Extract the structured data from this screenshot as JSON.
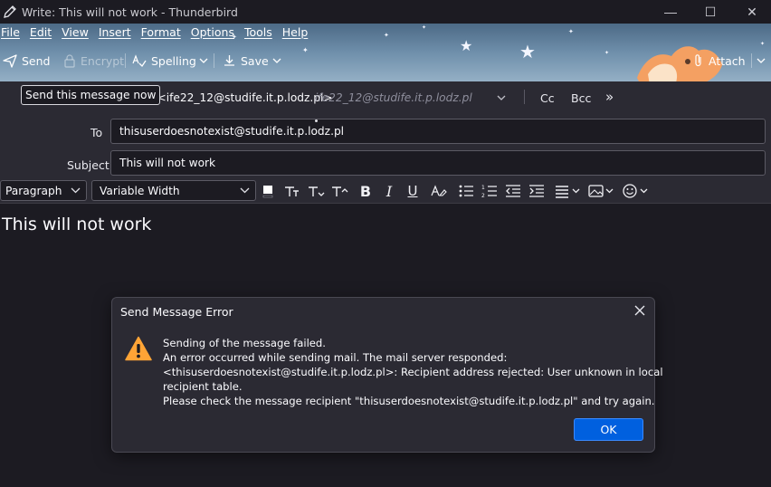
{
  "window": {
    "title": "Write: This will not work - Thunderbird",
    "minimize_glyph": "—",
    "maximize_glyph": "☐",
    "close_glyph": "✕"
  },
  "menubar": [
    "File",
    "Edit",
    "View",
    "Insert",
    "Format",
    "Options",
    "Tools",
    "Help"
  ],
  "toolbar": {
    "send": "Send",
    "encrypt": "Encrypt",
    "spelling": "Spelling",
    "save": "Save",
    "attach": "Attach"
  },
  "tooltip": "Send this message now",
  "compose": {
    "from_value": "_12 <ife22_12@studife.it.p.lodz.pl>",
    "from_identity": "ife22_12@studife.it.p.lodz.pl",
    "cc": "Cc",
    "bcc": "Bcc",
    "to_label": "To",
    "to_value": "thisuserdoesnotexist@studife.it.p.lodz.pl",
    "subject_label": "Subject",
    "subject_value": "This will not work"
  },
  "format_bar": {
    "paragraph": "Paragraph",
    "font": "Variable Width"
  },
  "body": {
    "text": "This will not work"
  },
  "dialog": {
    "title": "Send Message Error",
    "lines": [
      "Sending of the message failed.",
      "An error occurred while sending mail. The mail server responded:",
      "<thisuserdoesnotexist@studife.it.p.lodz.pl>: Recipient address rejected: User unknown in local",
      "recipient table.",
      "Please check the message recipient \"thisuserdoesnotexist@studife.it.p.lodz.pl\" and try again."
    ],
    "ok": "OK"
  },
  "colors": {
    "accent": "#0060df",
    "warning": "#ffa436",
    "background": "#1c1b22",
    "panel": "#2b2a33"
  }
}
